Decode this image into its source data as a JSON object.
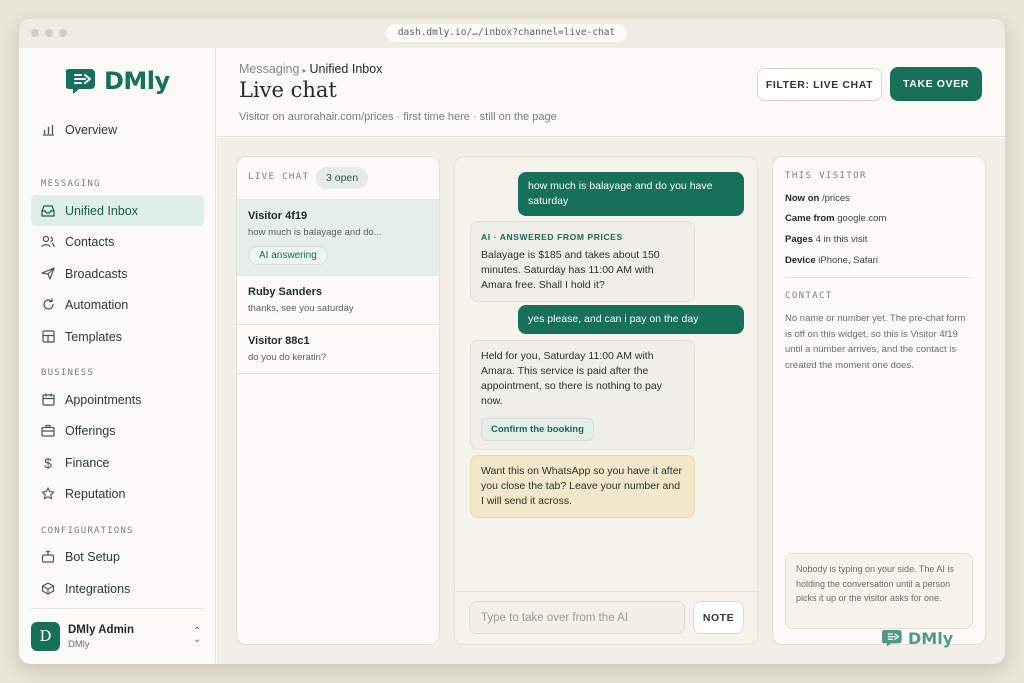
{
  "browser": {
    "url": "dash.dmly.io/…/inbox?channel=live-chat"
  },
  "brand": {
    "name": "DMly"
  },
  "sidebar": {
    "overview": "Overview",
    "sections": {
      "messaging": "MESSAGING",
      "business": "BUSINESS",
      "configurations": "CONFIGURATIONS"
    },
    "messaging_items": [
      "Unified Inbox",
      "Contacts",
      "Broadcasts",
      "Automation",
      "Templates"
    ],
    "business_items": [
      "Appointments",
      "Offerings",
      "Finance",
      "Reputation"
    ],
    "config_items": [
      "Bot Setup",
      "Integrations"
    ],
    "user": {
      "initial": "D",
      "name": "DMly Admin",
      "role": "DMly"
    }
  },
  "header": {
    "breadcrumb_parent": "Messaging",
    "breadcrumb_current": "Unified Inbox",
    "title": "Live chat",
    "subtitle": "Visitor on aurorahair.com/prices · first time here · still on the page",
    "filter_label": "FILTER: LIVE CHAT",
    "take_over_label": "TAKE OVER"
  },
  "list": {
    "heading": "LIVE CHAT",
    "open_count": "3 open",
    "conversations": [
      {
        "name": "Visitor 4f19",
        "preview": "how much is balayage and do...",
        "badge": "AI answering"
      },
      {
        "name": "Ruby Sanders",
        "preview": "thanks, see you saturday"
      },
      {
        "name": "Visitor 88c1",
        "preview": "do you do keratin?"
      }
    ]
  },
  "chat": {
    "messages": [
      {
        "from": "visitor",
        "text": "how much is balayage and do you have saturday"
      },
      {
        "from": "ai",
        "tag": "AI · ANSWERED FROM PRICES",
        "text": "Balayage is $185 and takes about 150 minutes. Saturday has 11:00 AM with Amara free. Shall I hold it?"
      },
      {
        "from": "visitor",
        "text": "yes please, and can i pay on the day"
      },
      {
        "from": "ai",
        "text": "Held for you, Saturday 11:00 AM with Amara. This service is paid after the appointment, so there is nothing to pay now.",
        "action": "Confirm the booking"
      },
      {
        "from": "ai",
        "text": "Want this on WhatsApp so you have it after you close the tab? Leave your number and I will send it across."
      }
    ],
    "composer_placeholder": "Type to take over from the AI",
    "note_label": "NOTE"
  },
  "visitor": {
    "heading": "THIS VISITOR",
    "now_on_label": "Now on",
    "now_on_value": "/prices",
    "came_from_label": "Came from",
    "came_from_value": "google.com",
    "pages_label": "Pages",
    "pages_value": "4 in this visit",
    "device_label": "Device",
    "device_value": "iPhone, Safari",
    "contact_heading": "CONTACT",
    "contact_text": "No name or number yet. The pre-chat form is off on this widget, so this is Visitor 4f19 until a number arrives, and the contact is created the moment one does.",
    "typing_note": "Nobody is typing on your side. The AI is holding the conversation until a person picks it up or the visitor asks for one."
  },
  "colors": {
    "accent": "#17705a",
    "active_bg": "#dfeee6",
    "warm_bubble": "#f3e7c9"
  }
}
